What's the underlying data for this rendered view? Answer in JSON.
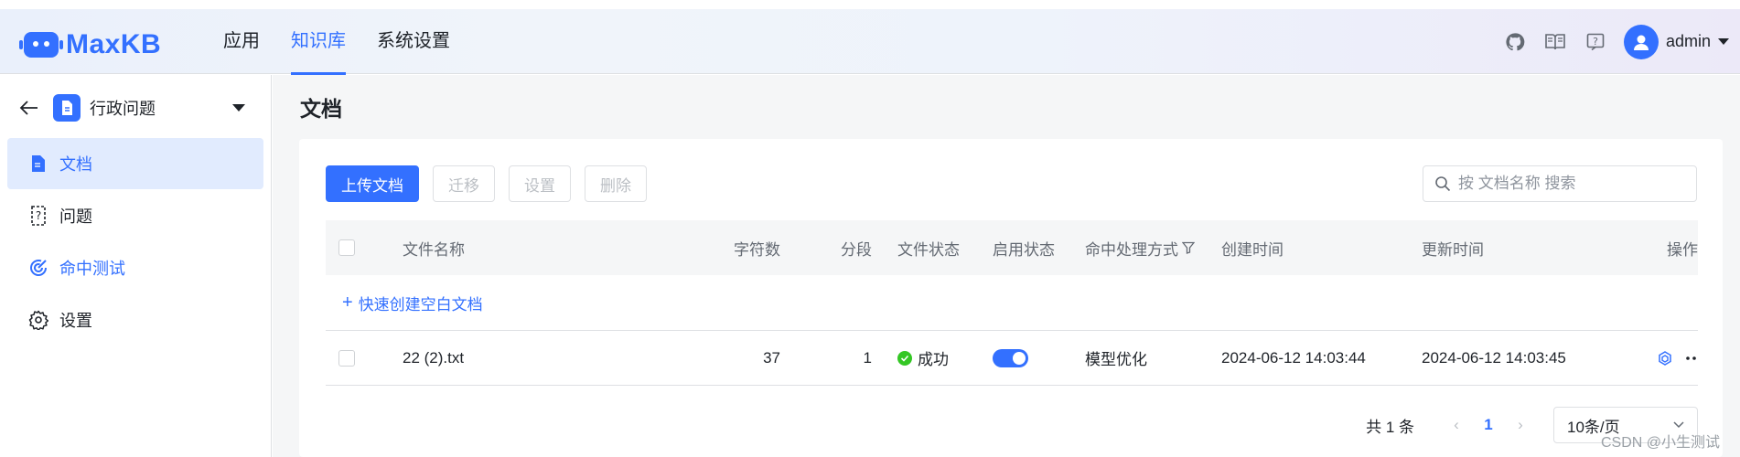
{
  "app": {
    "name": "MaxKB"
  },
  "nav": {
    "items": [
      {
        "label": "应用"
      },
      {
        "label": "知识库"
      },
      {
        "label": "系统设置"
      }
    ],
    "active": "知识库"
  },
  "header_icons": [
    "github-icon",
    "book-icon",
    "help-icon"
  ],
  "user": {
    "name": "admin"
  },
  "sidebar": {
    "kb_name": "行政问题",
    "items": [
      {
        "label": "文档",
        "icon": "document-icon"
      },
      {
        "label": "问题",
        "icon": "question-icon"
      },
      {
        "label": "命中测试",
        "icon": "target-icon"
      },
      {
        "label": "设置",
        "icon": "gear-icon"
      }
    ]
  },
  "page": {
    "title": "文档"
  },
  "toolbar": {
    "upload_label": "上传文档",
    "migrate_label": "迁移",
    "settings_label": "设置",
    "delete_label": "删除"
  },
  "search": {
    "placeholder": "按 文档名称 搜索",
    "value": ""
  },
  "table": {
    "columns": {
      "name": "文件名称",
      "chars": "字符数",
      "segments": "分段",
      "file_status": "文件状态",
      "enable_status": "启用状态",
      "hit_method": "命中处理方式",
      "created": "创建时间",
      "updated": "更新时间",
      "ops": "操作"
    },
    "quick_create": "快速创建空白文档",
    "rows": [
      {
        "name": "22 (2).txt",
        "chars": "37",
        "segments": "1",
        "file_status": "成功",
        "enabled": true,
        "hit_method": "模型优化",
        "created": "2024-06-12 14:03:44",
        "updated": "2024-06-12 14:03:45"
      }
    ]
  },
  "pagination": {
    "total": "共 1 条",
    "current": "1",
    "page_size": "10条/页"
  },
  "watermark": "CSDN @小生测试",
  "colors": {
    "accent": "#3370ff",
    "success": "#34c724"
  }
}
